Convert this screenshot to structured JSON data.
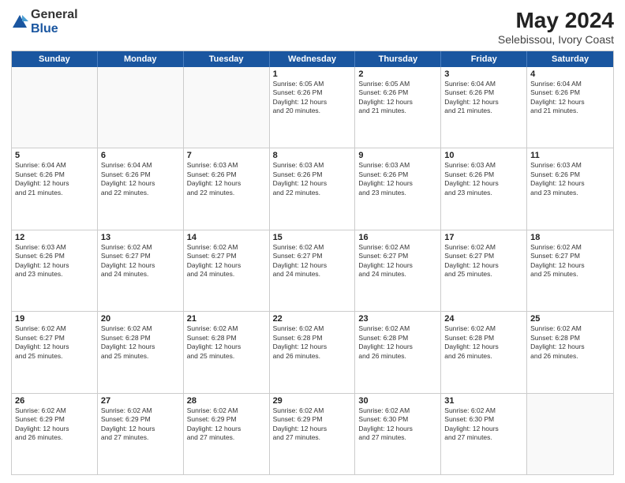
{
  "header": {
    "logo_general": "General",
    "logo_blue": "Blue",
    "month_title": "May 2024",
    "location": "Selebissou, Ivory Coast"
  },
  "weekdays": [
    "Sunday",
    "Monday",
    "Tuesday",
    "Wednesday",
    "Thursday",
    "Friday",
    "Saturday"
  ],
  "rows": [
    [
      {
        "day": "",
        "info": ""
      },
      {
        "day": "",
        "info": ""
      },
      {
        "day": "",
        "info": ""
      },
      {
        "day": "1",
        "info": "Sunrise: 6:05 AM\nSunset: 6:26 PM\nDaylight: 12 hours\nand 20 minutes."
      },
      {
        "day": "2",
        "info": "Sunrise: 6:05 AM\nSunset: 6:26 PM\nDaylight: 12 hours\nand 21 minutes."
      },
      {
        "day": "3",
        "info": "Sunrise: 6:04 AM\nSunset: 6:26 PM\nDaylight: 12 hours\nand 21 minutes."
      },
      {
        "day": "4",
        "info": "Sunrise: 6:04 AM\nSunset: 6:26 PM\nDaylight: 12 hours\nand 21 minutes."
      }
    ],
    [
      {
        "day": "5",
        "info": "Sunrise: 6:04 AM\nSunset: 6:26 PM\nDaylight: 12 hours\nand 21 minutes."
      },
      {
        "day": "6",
        "info": "Sunrise: 6:04 AM\nSunset: 6:26 PM\nDaylight: 12 hours\nand 22 minutes."
      },
      {
        "day": "7",
        "info": "Sunrise: 6:03 AM\nSunset: 6:26 PM\nDaylight: 12 hours\nand 22 minutes."
      },
      {
        "day": "8",
        "info": "Sunrise: 6:03 AM\nSunset: 6:26 PM\nDaylight: 12 hours\nand 22 minutes."
      },
      {
        "day": "9",
        "info": "Sunrise: 6:03 AM\nSunset: 6:26 PM\nDaylight: 12 hours\nand 23 minutes."
      },
      {
        "day": "10",
        "info": "Sunrise: 6:03 AM\nSunset: 6:26 PM\nDaylight: 12 hours\nand 23 minutes."
      },
      {
        "day": "11",
        "info": "Sunrise: 6:03 AM\nSunset: 6:26 PM\nDaylight: 12 hours\nand 23 minutes."
      }
    ],
    [
      {
        "day": "12",
        "info": "Sunrise: 6:03 AM\nSunset: 6:26 PM\nDaylight: 12 hours\nand 23 minutes."
      },
      {
        "day": "13",
        "info": "Sunrise: 6:02 AM\nSunset: 6:27 PM\nDaylight: 12 hours\nand 24 minutes."
      },
      {
        "day": "14",
        "info": "Sunrise: 6:02 AM\nSunset: 6:27 PM\nDaylight: 12 hours\nand 24 minutes."
      },
      {
        "day": "15",
        "info": "Sunrise: 6:02 AM\nSunset: 6:27 PM\nDaylight: 12 hours\nand 24 minutes."
      },
      {
        "day": "16",
        "info": "Sunrise: 6:02 AM\nSunset: 6:27 PM\nDaylight: 12 hours\nand 24 minutes."
      },
      {
        "day": "17",
        "info": "Sunrise: 6:02 AM\nSunset: 6:27 PM\nDaylight: 12 hours\nand 25 minutes."
      },
      {
        "day": "18",
        "info": "Sunrise: 6:02 AM\nSunset: 6:27 PM\nDaylight: 12 hours\nand 25 minutes."
      }
    ],
    [
      {
        "day": "19",
        "info": "Sunrise: 6:02 AM\nSunset: 6:27 PM\nDaylight: 12 hours\nand 25 minutes."
      },
      {
        "day": "20",
        "info": "Sunrise: 6:02 AM\nSunset: 6:28 PM\nDaylight: 12 hours\nand 25 minutes."
      },
      {
        "day": "21",
        "info": "Sunrise: 6:02 AM\nSunset: 6:28 PM\nDaylight: 12 hours\nand 25 minutes."
      },
      {
        "day": "22",
        "info": "Sunrise: 6:02 AM\nSunset: 6:28 PM\nDaylight: 12 hours\nand 26 minutes."
      },
      {
        "day": "23",
        "info": "Sunrise: 6:02 AM\nSunset: 6:28 PM\nDaylight: 12 hours\nand 26 minutes."
      },
      {
        "day": "24",
        "info": "Sunrise: 6:02 AM\nSunset: 6:28 PM\nDaylight: 12 hours\nand 26 minutes."
      },
      {
        "day": "25",
        "info": "Sunrise: 6:02 AM\nSunset: 6:28 PM\nDaylight: 12 hours\nand 26 minutes."
      }
    ],
    [
      {
        "day": "26",
        "info": "Sunrise: 6:02 AM\nSunset: 6:29 PM\nDaylight: 12 hours\nand 26 minutes."
      },
      {
        "day": "27",
        "info": "Sunrise: 6:02 AM\nSunset: 6:29 PM\nDaylight: 12 hours\nand 27 minutes."
      },
      {
        "day": "28",
        "info": "Sunrise: 6:02 AM\nSunset: 6:29 PM\nDaylight: 12 hours\nand 27 minutes."
      },
      {
        "day": "29",
        "info": "Sunrise: 6:02 AM\nSunset: 6:29 PM\nDaylight: 12 hours\nand 27 minutes."
      },
      {
        "day": "30",
        "info": "Sunrise: 6:02 AM\nSunset: 6:30 PM\nDaylight: 12 hours\nand 27 minutes."
      },
      {
        "day": "31",
        "info": "Sunrise: 6:02 AM\nSunset: 6:30 PM\nDaylight: 12 hours\nand 27 minutes."
      },
      {
        "day": "",
        "info": ""
      }
    ]
  ]
}
